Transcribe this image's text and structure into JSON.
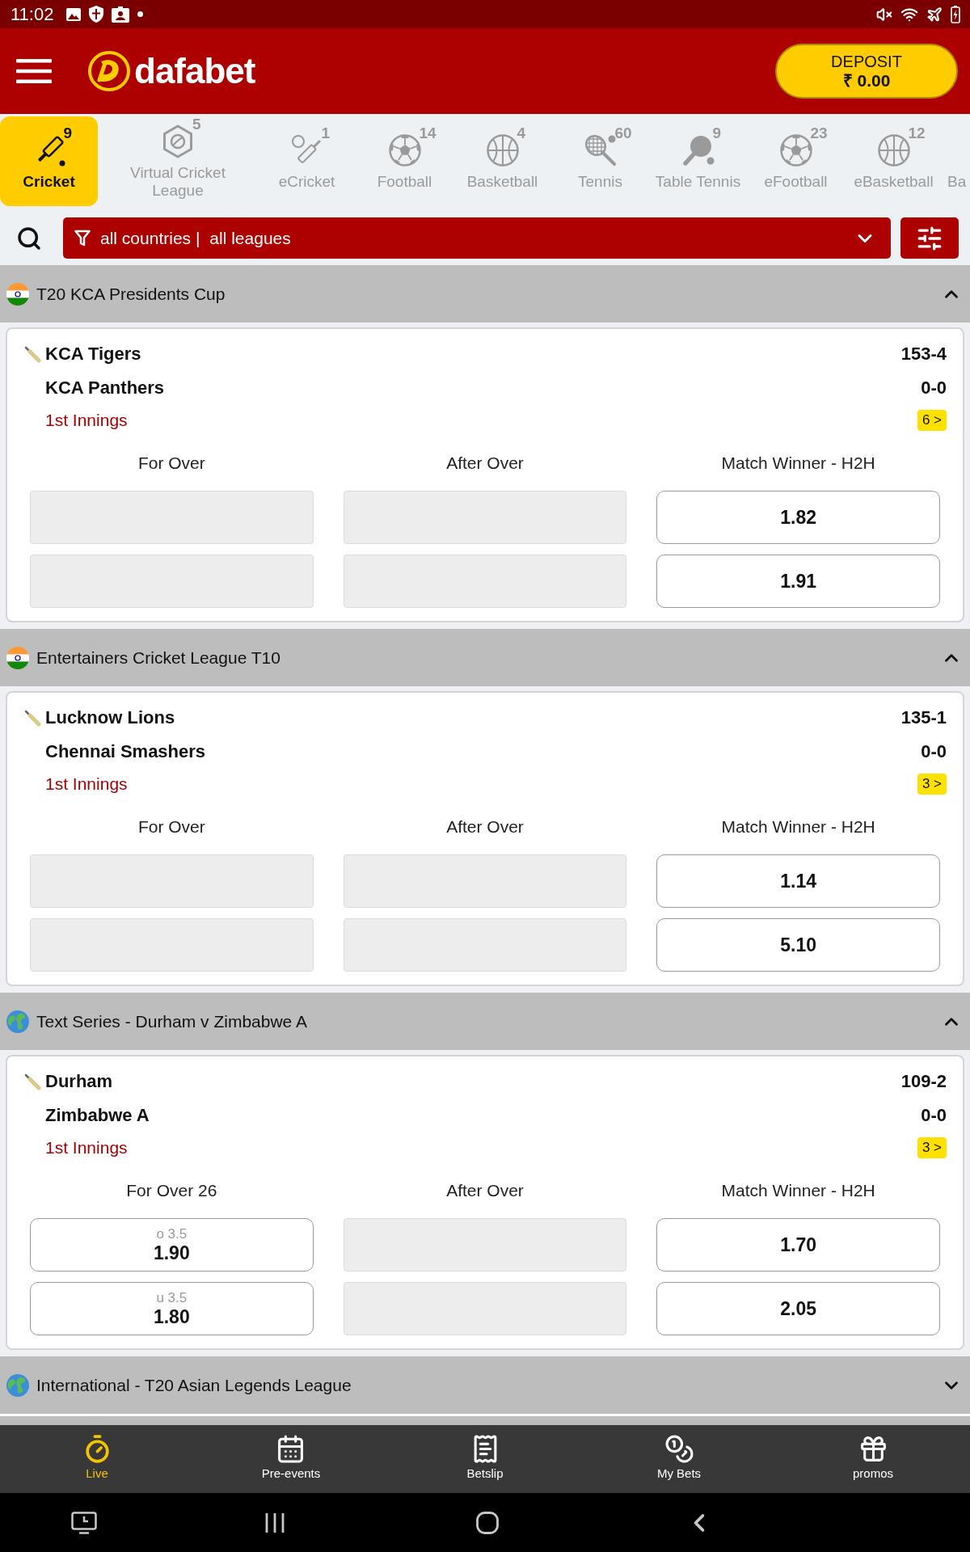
{
  "status_bar": {
    "time": "11:02"
  },
  "header": {
    "logo": "dafabet",
    "deposit": {
      "label": "DEPOSIT",
      "amount": "₹ 0.00"
    }
  },
  "sports_tabs": [
    {
      "label": "Cricket",
      "count": "9",
      "selected": true
    },
    {
      "label": "Virtual Cricket League",
      "count": "5",
      "selected": false
    },
    {
      "label": "eCricket",
      "count": "1",
      "selected": false
    },
    {
      "label": "Football",
      "count": "14",
      "selected": false
    },
    {
      "label": "Basketball",
      "count": "4",
      "selected": false
    },
    {
      "label": "Tennis",
      "count": "60",
      "selected": false
    },
    {
      "label": "Table Tennis",
      "count": "9",
      "selected": false
    },
    {
      "label": "eFootball",
      "count": "23",
      "selected": false
    },
    {
      "label": "eBasketball",
      "count": "12",
      "selected": false
    },
    {
      "label": "Ba",
      "selected": false
    }
  ],
  "filter": {
    "countries": "all countries |",
    "leagues": "all leagues"
  },
  "leagues": [
    {
      "kind": "country",
      "title": "T20 KCA Presidents Cup",
      "expanded": true,
      "match": {
        "teams": [
          {
            "name": "KCA Tigers",
            "score": "153-4",
            "batting": true
          },
          {
            "name": "KCA Panthers",
            "score": "0-0",
            "batting": false
          }
        ],
        "period": "1st Innings",
        "more": "6 >",
        "markets": [
          {
            "title": "For Over",
            "odds": [
              {
                "active": false
              },
              {
                "active": false
              }
            ]
          },
          {
            "title": "After Over",
            "odds": [
              {
                "active": false
              },
              {
                "active": false
              }
            ]
          },
          {
            "title": "Match Winner - H2H",
            "odds": [
              {
                "active": true,
                "price": "1.82"
              },
              {
                "active": true,
                "price": "1.91"
              }
            ]
          }
        ]
      }
    },
    {
      "kind": "country",
      "title": "Entertainers Cricket League T10",
      "expanded": true,
      "match": {
        "teams": [
          {
            "name": "Lucknow Lions",
            "score": "135-1",
            "batting": true
          },
          {
            "name": "Chennai Smashers",
            "score": "0-0",
            "batting": false
          }
        ],
        "period": "1st Innings",
        "more": "3 >",
        "markets": [
          {
            "title": "For Over",
            "odds": [
              {
                "active": false
              },
              {
                "active": false
              }
            ]
          },
          {
            "title": "After Over",
            "odds": [
              {
                "active": false
              },
              {
                "active": false
              }
            ]
          },
          {
            "title": "Match Winner - H2H",
            "odds": [
              {
                "active": true,
                "price": "1.14"
              },
              {
                "active": true,
                "price": "5.10"
              }
            ]
          }
        ]
      }
    },
    {
      "kind": "world",
      "title": "Text Series - Durham v Zimbabwe A",
      "expanded": true,
      "match": {
        "teams": [
          {
            "name": "Durham",
            "score": "109-2",
            "batting": true
          },
          {
            "name": "Zimbabwe A",
            "score": "0-0",
            "batting": false
          }
        ],
        "period": "1st Innings",
        "more": "3 >",
        "markets": [
          {
            "title": "For Over 26",
            "odds": [
              {
                "active": true,
                "line": "o 3.5",
                "price": "1.90"
              },
              {
                "active": true,
                "line": "u 3.5",
                "price": "1.80"
              }
            ]
          },
          {
            "title": "After Over",
            "odds": [
              {
                "active": false
              },
              {
                "active": false
              }
            ]
          },
          {
            "title": "Match Winner - H2H",
            "odds": [
              {
                "active": true,
                "price": "1.70"
              },
              {
                "active": true,
                "price": "2.05"
              }
            ]
          }
        ]
      }
    },
    {
      "kind": "world",
      "title": "International - T20 Asian Legends League",
      "expanded": false
    }
  ],
  "bottom_nav": [
    {
      "label": "Live",
      "selected": true
    },
    {
      "label": "Pre-events",
      "selected": false
    },
    {
      "label": "Betslip",
      "selected": false
    },
    {
      "label": "My Bets",
      "selected": false
    },
    {
      "label": "promos",
      "selected": false
    }
  ]
}
